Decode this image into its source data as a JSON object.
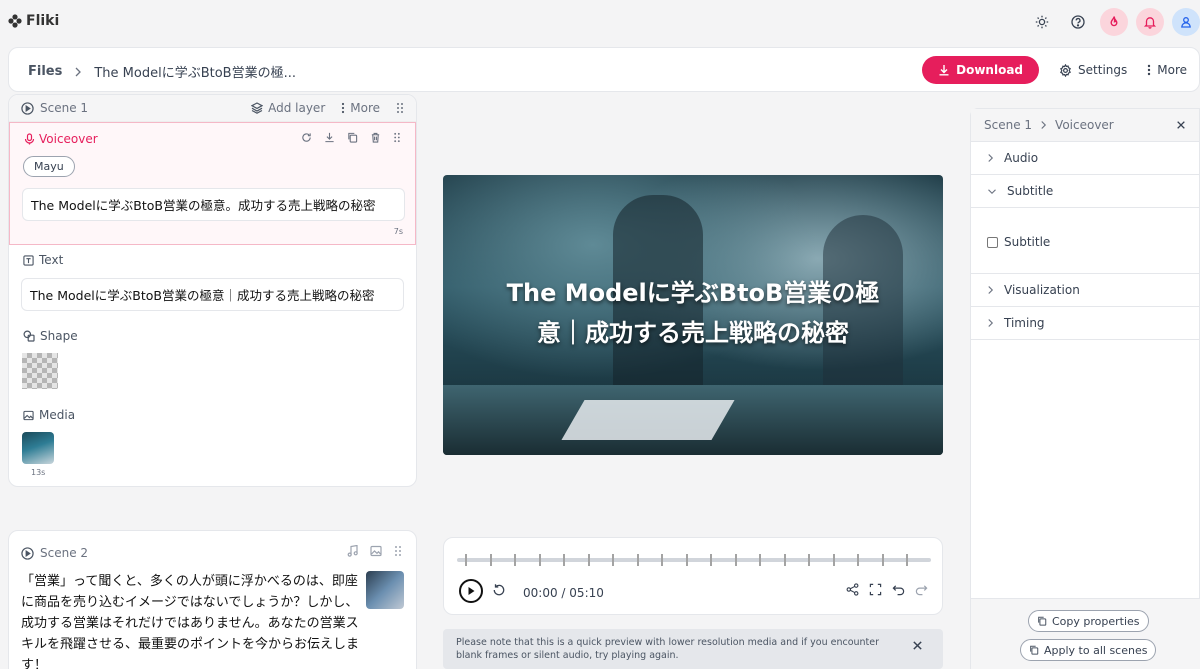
{
  "app": {
    "name": "Fliki"
  },
  "header": {
    "files_label": "Files",
    "project_title": "The Modelに学ぶBtoB営業の極...",
    "download_label": "Download",
    "settings_label": "Settings",
    "more_label": "More",
    "accent": "#e61e5c"
  },
  "scene1": {
    "label": "Scene 1",
    "add_layer_label": "Add layer",
    "more_label": "More",
    "voiceover": {
      "label": "Voiceover",
      "voice_name": "Mayu",
      "script": "The Modelに学ぶBtoB営業の極意。成功する売上戦略の秘密",
      "duration": "7s"
    },
    "text": {
      "label": "Text",
      "value": "The Modelに学ぶBtoB営業の極意｜成功する売上戦略の秘密"
    },
    "shape": {
      "label": "Shape"
    },
    "media": {
      "label": "Media",
      "duration": "13s"
    }
  },
  "scene2": {
    "label": "Scene 2",
    "script": "「営業」って聞くと、多くの人が頭に浮かべるのは、即座に商品を売り込むイメージではないでしょうか？しかし、成功する営業はそれだけではありません。あなたの営業スキルを飛躍させる、最重要のポイントを今からお伝えします！"
  },
  "preview": {
    "caption_line1": "The Modelに学ぶBtoB営業の極",
    "caption_line2": "意｜成功する売上戦略の秘密"
  },
  "player": {
    "current_time": "00:00",
    "separator": "/",
    "total_time": "05:10",
    "progress": 0
  },
  "notice": {
    "message": "Please note that this is a quick preview with lower resolution media and if you encounter blank frames or silent audio, try playing again."
  },
  "right_panel": {
    "crumb_scene": "Scene 1",
    "crumb_section": "Voiceover",
    "sections": [
      {
        "label": "Audio",
        "expanded": false
      },
      {
        "label": "Subtitle",
        "expanded": true
      },
      {
        "label": "Visualization",
        "expanded": false
      },
      {
        "label": "Timing",
        "expanded": false
      }
    ],
    "subtitle_checkbox_label": "Subtitle",
    "subtitle_checked": false,
    "copy_properties_label": "Copy properties",
    "apply_all_label": "Apply to all scenes"
  }
}
